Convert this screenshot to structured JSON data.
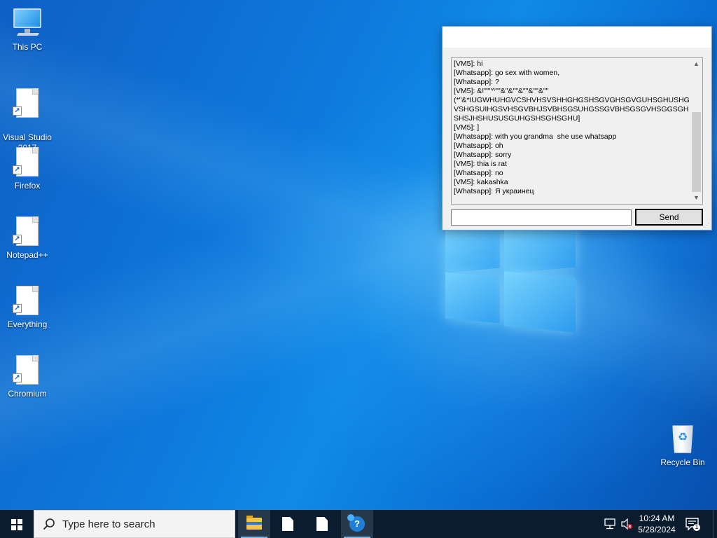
{
  "desktop": {
    "icons": [
      {
        "label": "This PC",
        "icon": "computer-icon"
      },
      {
        "label": "Visual Studio\n2017",
        "icon": "file-shortcut-icon"
      },
      {
        "label": "Firefox",
        "icon": "file-shortcut-icon"
      },
      {
        "label": "Notepad++",
        "icon": "file-shortcut-icon"
      },
      {
        "label": "Everything",
        "icon": "file-shortcut-icon"
      },
      {
        "label": "Chromium",
        "icon": "file-shortcut-icon"
      },
      {
        "label": "Recycle Bin",
        "icon": "recycle-bin-icon"
      }
    ]
  },
  "chat": {
    "title": "",
    "lines": [
      "[VM5]: hi",
      "[Whatsapp]: go sex with women,",
      "[Whatsapp]: ?",
      "[VM5]: &!\"\"\"^\"\"&\"&\"\"&\"\"&\"\"&\"\"",
      "(*\"&*IUGWHUHGVCSHVHSVSHHGHGSHSGVGHSGVGUHSGHUSHGVSHGSUIHGSVHSGVBHJSVBHSGSUHGSSGVBHSGSGVHSGGSGHSHSJHSHUSUSGUHGSHSGHSGHU]",
      "[VM5]: ]",
      "[Whatsapp]: with you grandma  she use whatsapp",
      "[Whatsapp]: oh",
      "[Whatsapp]: sorry",
      "[VM5]: thia is rat",
      "[Whatsapp]: no",
      "[VM5]: kakashka",
      "[Whatsapp]: Я украинец"
    ],
    "input_value": "",
    "send_label": "Send"
  },
  "taskbar": {
    "search_placeholder": "Type here to search",
    "apps": [
      "file-explorer-icon",
      "document-icon",
      "document-icon",
      "help-icon"
    ],
    "tray_icons": [
      "network-icon",
      "volume-muted-icon"
    ],
    "time": "10:24 AM",
    "date": "5/28/2024",
    "notification_count": "1"
  }
}
